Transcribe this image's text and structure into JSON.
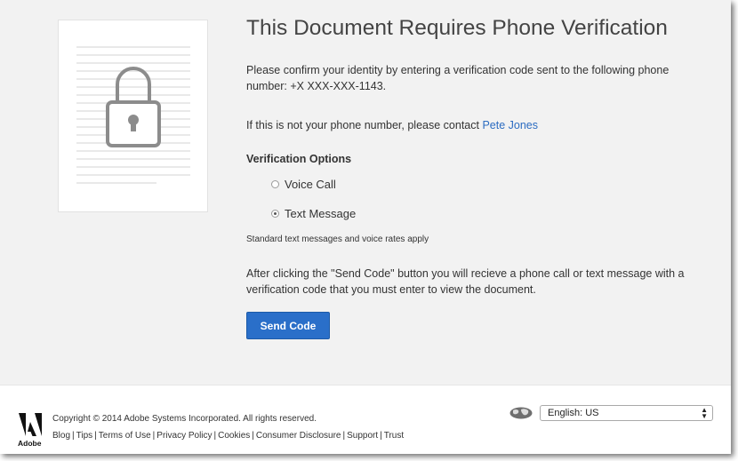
{
  "page": {
    "title": "This Document Requires Phone Verification",
    "intro": "Please confirm your identity by entering a verification code sent to the following phone number: +X XXX-XXX-1143.",
    "contact_prefix": "If this is not your phone number, please contact ",
    "contact_name": "Pete Jones"
  },
  "verification": {
    "heading": "Verification Options",
    "options": [
      {
        "label": "Voice Call",
        "selected": false
      },
      {
        "label": "Text Message",
        "selected": true
      }
    ],
    "rates_note": "Standard text messages and voice rates apply",
    "instructions": "After clicking the \"Send Code\" button you will recieve a phone call or text message with a verification code that you must enter to view the document.",
    "send_button": "Send Code"
  },
  "footer": {
    "logo_text": "Adobe",
    "copyright": "Copyright © 2014 Adobe Systems Incorporated. All rights reserved.",
    "links": [
      "Blog",
      "Tips",
      "Terms of Use",
      "Privacy Policy",
      "Cookies",
      "Consumer Disclosure",
      "Support",
      "Trust"
    ],
    "language": "English: US"
  },
  "colors": {
    "accent": "#2a6fc9",
    "link": "#2c6cc1",
    "background": "#f2f2f2"
  },
  "icons": {
    "document": "lock-document-icon",
    "globe": "globe-icon",
    "logo": "adobe-logo"
  }
}
